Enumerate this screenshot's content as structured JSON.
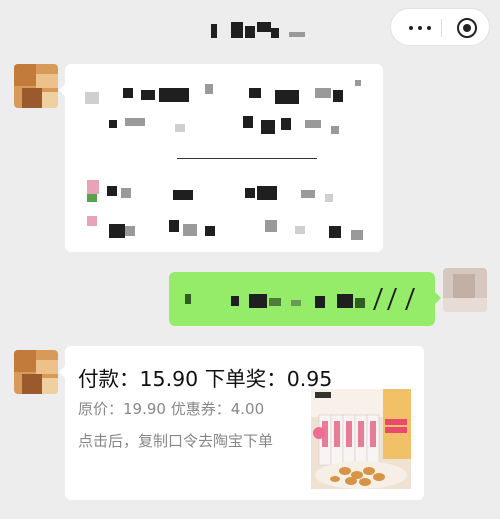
{
  "header": {
    "title": "",
    "more_icon": "more-dots-icon",
    "close_icon": "target-icon"
  },
  "messages": [
    {
      "side": "left",
      "type": "text",
      "content": ""
    },
    {
      "side": "right",
      "type": "text",
      "content": ""
    },
    {
      "side": "left",
      "type": "product-card",
      "pay_line": "付款：15.90 下单奖：0.95",
      "price_line": "原价：19.90 优惠券：4.00",
      "hint_line": "点击后，复制口令去陶宝下单"
    }
  ],
  "colors": {
    "background": "#ededed",
    "bubble_sent": "#95ec69",
    "bubble_received": "#ffffff"
  }
}
